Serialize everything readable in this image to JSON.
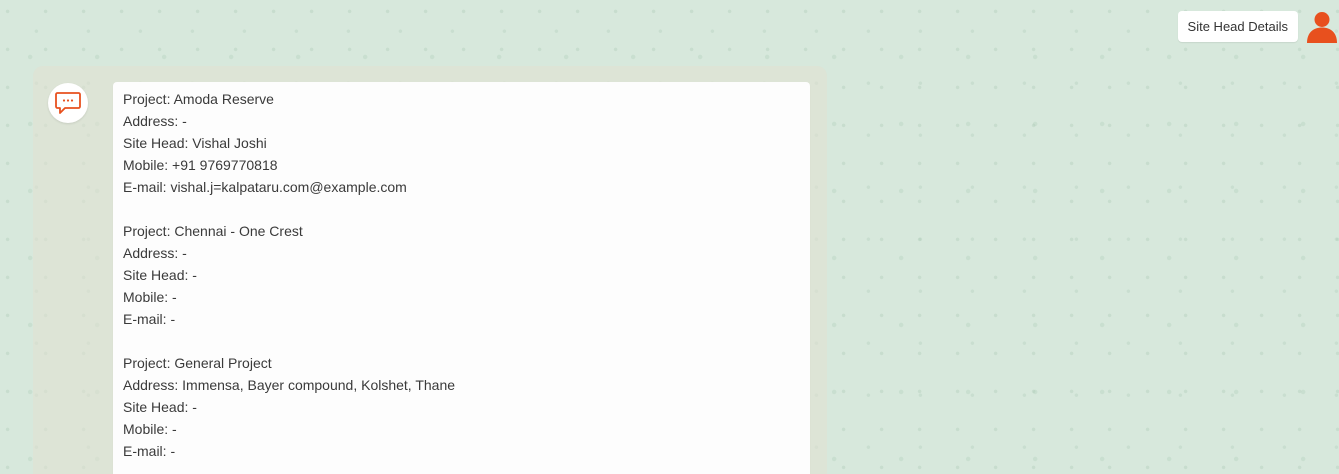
{
  "user_message": {
    "text": "Site Head Details"
  },
  "icons": {
    "user_avatar": "person-icon",
    "bot_avatar": "chat-bubble-icon",
    "accent_color": "#e8501e"
  },
  "bot_message": {
    "projects": [
      {
        "project": "Project: Amoda Reserve",
        "address": "Address: -",
        "site_head": "Site Head: Vishal Joshi",
        "mobile": "Mobile: +91 9769770818",
        "email": "E-mail: vishal.j=kalpataru.com@example.com"
      },
      {
        "project": "Project: Chennai - One Crest",
        "address": "Address: -",
        "site_head": "Site Head: -",
        "mobile": "Mobile: -",
        "email": "E-mail: -"
      },
      {
        "project": "Project: General Project",
        "address": "Address: Immensa, Bayer compound, Kolshet, Thane",
        "site_head": "Site Head: -",
        "mobile": "Mobile: -",
        "email": "E-mail: -"
      }
    ]
  }
}
